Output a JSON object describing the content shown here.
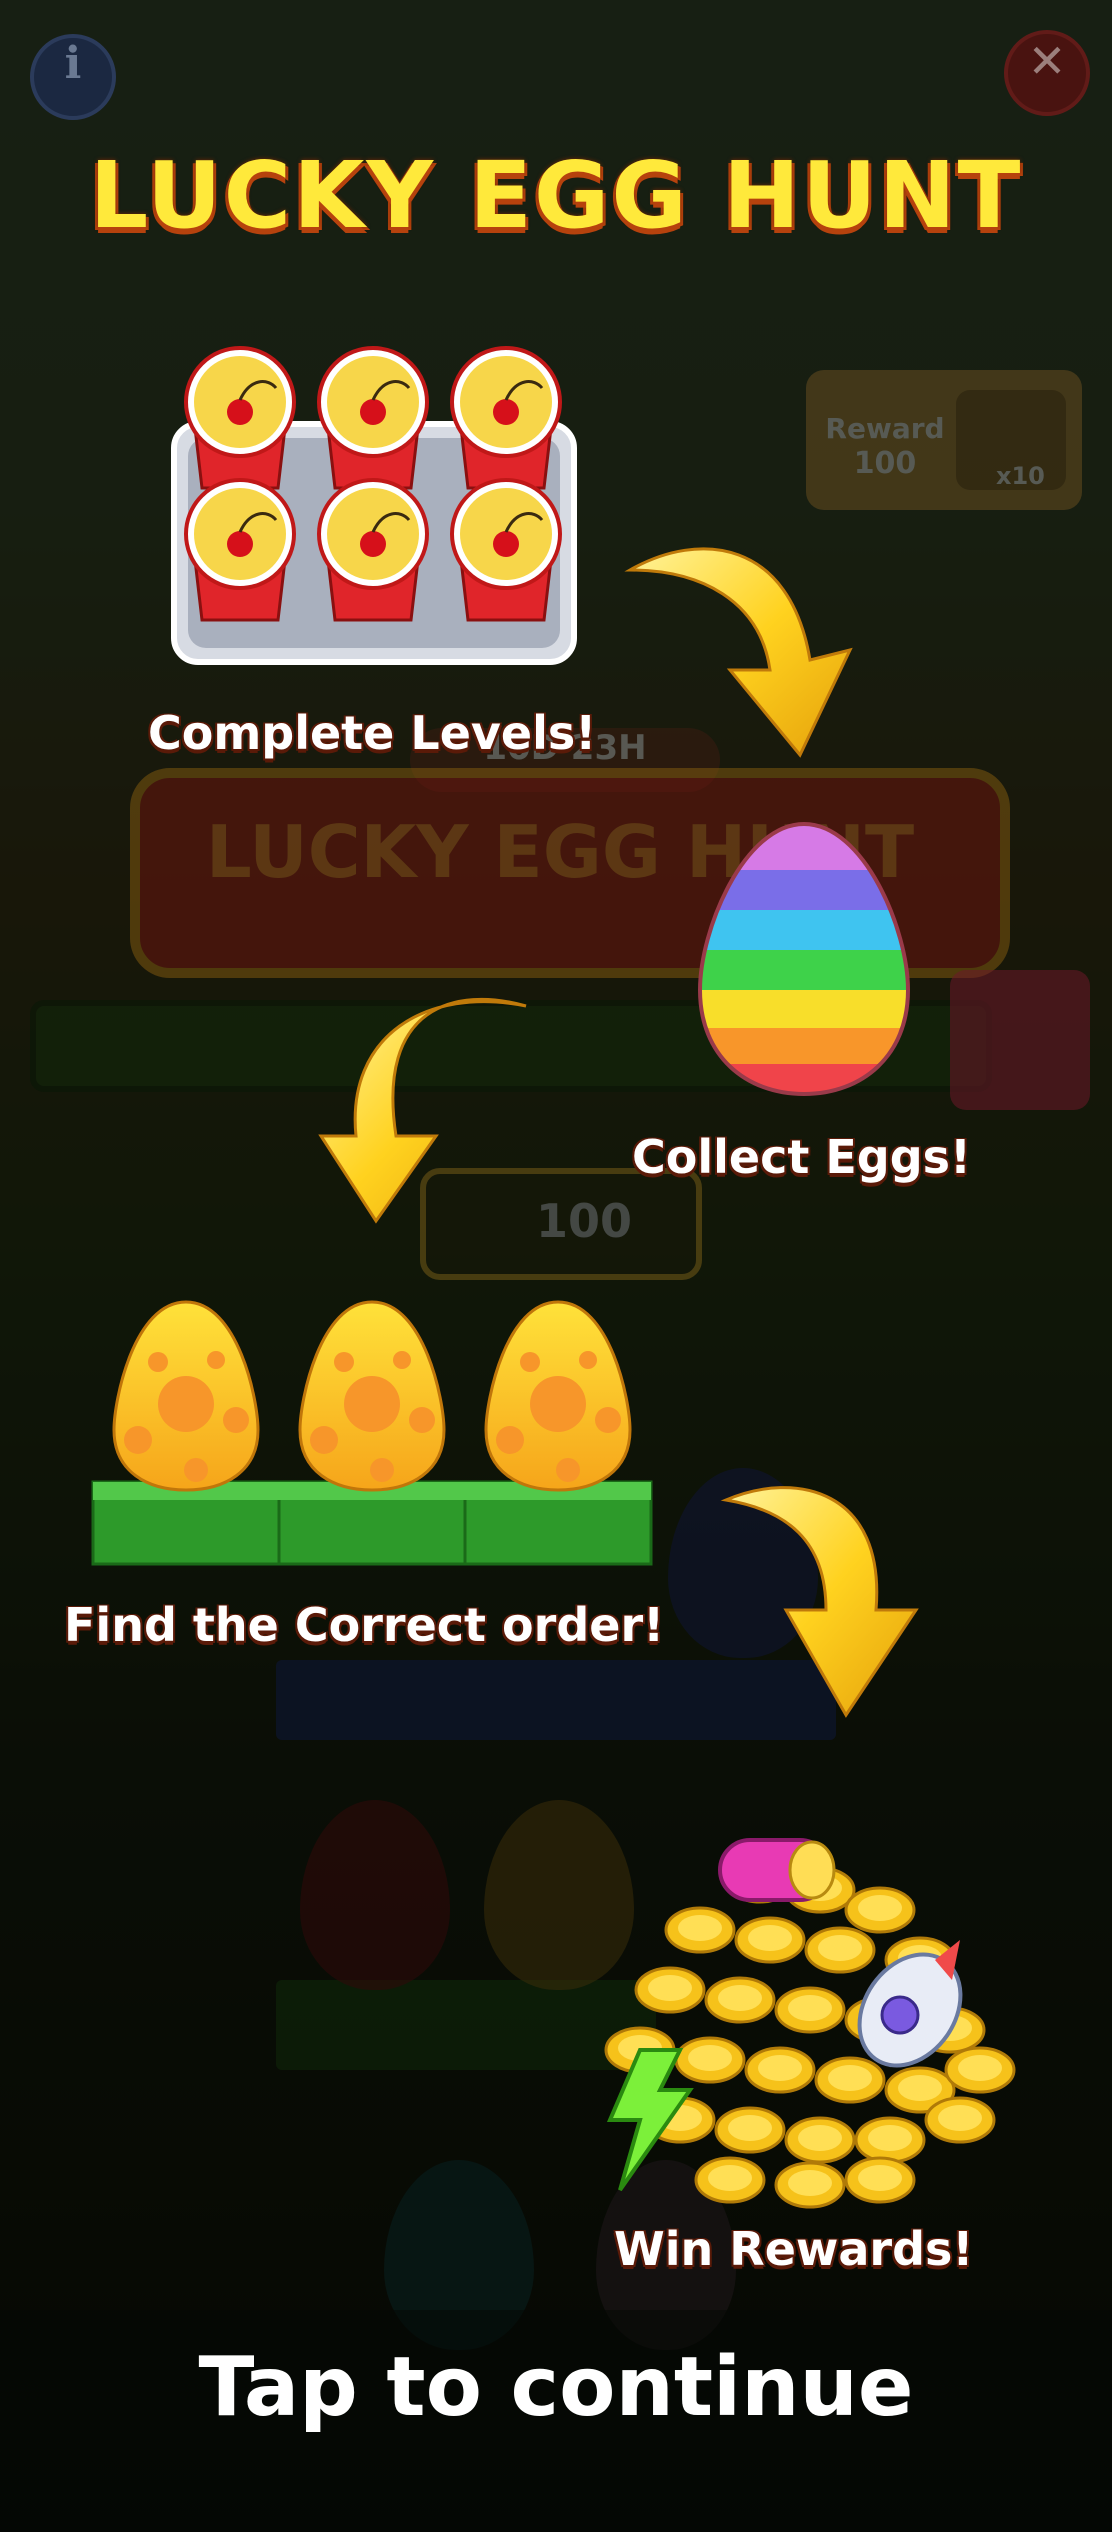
{
  "title": "LUCKY EGG HUNT",
  "steps": [
    {
      "label": "Complete Levels!"
    },
    {
      "label": "Collect Eggs!"
    },
    {
      "label": "Find the Correct order!"
    },
    {
      "label": "Win Rewards!"
    }
  ],
  "background": {
    "timer": "10D 23H",
    "banner": "LUCKY EGG HUNT",
    "reward_label": "Reward",
    "reward_value": "100",
    "reward_multiplier": "x10",
    "egg_count": "100"
  },
  "footer": {
    "tap_label": "Tap to continue"
  },
  "icons": [
    "info-icon",
    "close-icon"
  ],
  "colors": {
    "title": "#ffe93b",
    "title_shadow": "#b6420d",
    "text": "#ffffff"
  }
}
